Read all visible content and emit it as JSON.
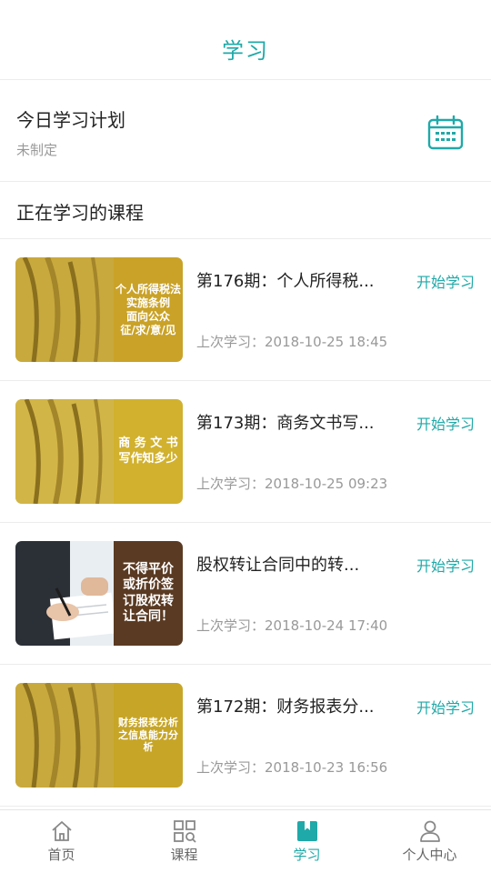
{
  "header": {
    "title": "学习"
  },
  "plan": {
    "title": "今日学习计划",
    "status": "未制定",
    "icon": "calendar-icon"
  },
  "section": {
    "title": "正在学习的课程"
  },
  "last_prefix": "上次学习：",
  "courses": [
    {
      "title": "第176期：个人所得税...",
      "start_label": "开始学习",
      "last_time": "2018-10-25 18:45",
      "thumb_lines": [
        "个人所得税法",
        "实施条例",
        "面向公众",
        "征/求/意/见"
      ],
      "thumb_bg": "#c9a227"
    },
    {
      "title": "第173期：商务文书写...",
      "start_label": "开始学习",
      "last_time": "2018-10-25 09:23",
      "thumb_lines": [
        "商 务 文 书",
        "写作知多少"
      ],
      "thumb_bg": "#d1b12e"
    },
    {
      "title": "股权转让合同中的转...",
      "start_label": "开始学习",
      "last_time": "2018-10-24 17:40",
      "thumb_lines": [
        "不得平价",
        "或折价签",
        "订股权转",
        "让合同！"
      ],
      "thumb_bg": "#5a3a22"
    },
    {
      "title": "第172期：财务报表分...",
      "start_label": "开始学习",
      "last_time": "2018-10-23 16:56",
      "thumb_lines": [
        "财务报表分析",
        "之信息能力分析"
      ],
      "thumb_bg": "#c7a526"
    }
  ],
  "tabs": [
    {
      "label": "首页",
      "icon": "home-icon",
      "active": false
    },
    {
      "label": "课程",
      "icon": "grid-search-icon",
      "active": false
    },
    {
      "label": "学习",
      "icon": "book-icon",
      "active": true
    },
    {
      "label": "个人中心",
      "icon": "person-icon",
      "active": false
    }
  ],
  "colors": {
    "accent": "#1fa9a8",
    "muted": "#999999",
    "divider": "#ececec"
  }
}
